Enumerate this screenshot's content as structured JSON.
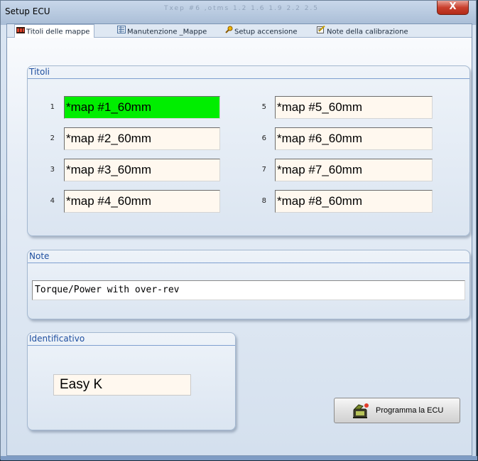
{
  "window": {
    "title": "Setup ECU",
    "titlebar_ghost": "Txep #6 ,otms   1.2   1.6   1.9   2.2   2.5",
    "close_label": "X"
  },
  "tabs": [
    {
      "label": "Titoli delle mappe",
      "icon": "map-title-icon",
      "active": true
    },
    {
      "label": "Manutenzione _Mappe",
      "icon": "map-maintenance-icon",
      "active": false
    },
    {
      "label": "Setup accensione",
      "icon": "ignition-icon",
      "active": false
    },
    {
      "label": "Note della calibrazione",
      "icon": "notes-icon",
      "active": false
    }
  ],
  "titoli": {
    "label": "Titoli",
    "maps": [
      {
        "index": "1",
        "value": "*map #1_60mm",
        "selected": true
      },
      {
        "index": "2",
        "value": "*map #2_60mm",
        "selected": false
      },
      {
        "index": "3",
        "value": "*map #3_60mm",
        "selected": false
      },
      {
        "index": "4",
        "value": "*map #4_60mm",
        "selected": false
      },
      {
        "index": "5",
        "value": "*map #5_60mm",
        "selected": false
      },
      {
        "index": "6",
        "value": "*map #6_60mm",
        "selected": false
      },
      {
        "index": "7",
        "value": "*map #7_60mm",
        "selected": false
      },
      {
        "index": "8",
        "value": "*map #8_60mm",
        "selected": false
      }
    ]
  },
  "note": {
    "label": "Note",
    "value": "Torque/Power with over-rev"
  },
  "identificativo": {
    "label": "Identificativo",
    "value": "Easy K"
  },
  "program_button": {
    "label": "Programma la ECU",
    "icon": "ecu-program-icon"
  },
  "colors": {
    "selected_field": "#00ee00",
    "group_title": "#1f4f9f",
    "close_button": "#c9402e"
  }
}
